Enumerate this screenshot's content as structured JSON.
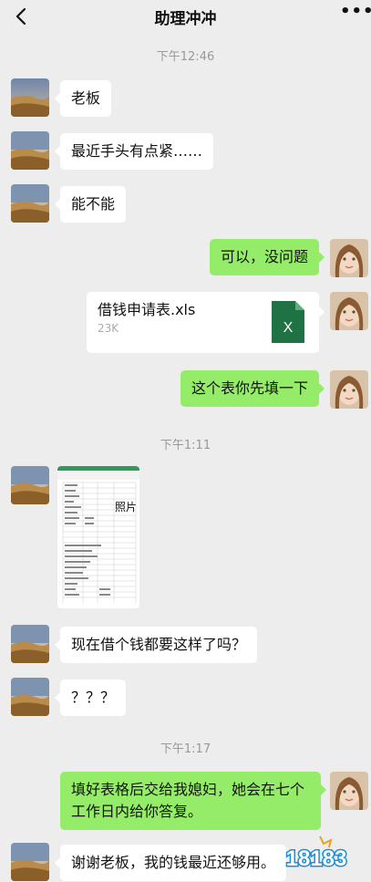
{
  "header": {
    "title": "助理冲冲",
    "more": "•••"
  },
  "timestamps": [
    "下午12:46",
    "下午1:11",
    "下午1:17"
  ],
  "messages": [
    {
      "from": "contact",
      "text": "老板"
    },
    {
      "from": "contact",
      "text": "最近手头有点紧……"
    },
    {
      "from": "contact",
      "text": "能不能"
    },
    {
      "from": "me",
      "text": "可以，没问题"
    },
    {
      "from": "me",
      "type": "file",
      "file_name": "借钱申请表.xls",
      "file_size": "23K",
      "file_icon": "excel-icon"
    },
    {
      "from": "me",
      "text": "这个表你先填一下"
    },
    {
      "from": "contact",
      "type": "image",
      "image_text": "照片",
      "image_desc": "spreadsheet-screenshot"
    },
    {
      "from": "contact",
      "text": "现在借个钱都要这样了吗？"
    },
    {
      "from": "contact",
      "text": "？？？"
    },
    {
      "from": "me",
      "text": "填好表格后交给我媳妇，她会在七个工作日内给你答复。"
    },
    {
      "from": "contact",
      "text": "谢谢老板，我的钱最近还够用。"
    }
  ],
  "watermark": {
    "text": "18183"
  },
  "colors": {
    "background": "#ededed",
    "outgoing": "#95ec69",
    "incoming": "#ffffff",
    "excel": "#1f7244"
  }
}
